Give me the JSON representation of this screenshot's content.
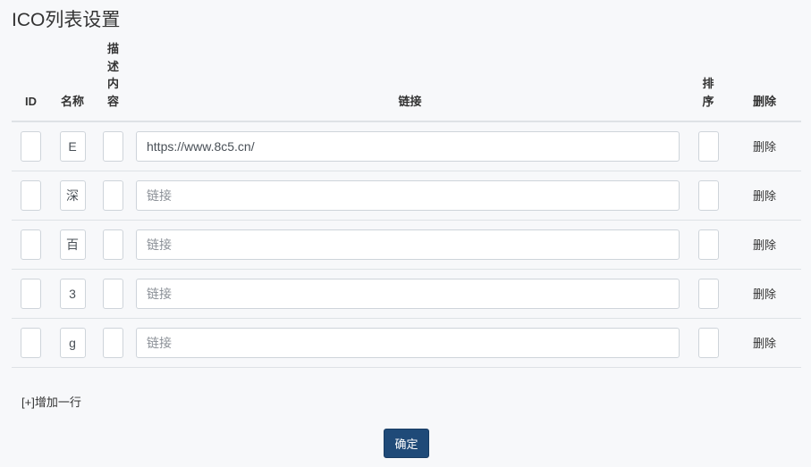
{
  "page": {
    "title": "ICO列表设置"
  },
  "table": {
    "headers": {
      "id": "ID",
      "name": "名称",
      "desc": "描述内容",
      "link": "链接",
      "sort": "排序",
      "delete": "删除"
    },
    "rows": [
      {
        "id": "",
        "name": "E",
        "desc": "",
        "link": "https://www.8c5.cn/",
        "link_placeholder": "链接",
        "sort": "",
        "delete_label": "删除"
      },
      {
        "id": "",
        "name": "深",
        "desc": "",
        "link": "",
        "link_placeholder": "链接",
        "sort": "",
        "delete_label": "删除"
      },
      {
        "id": "",
        "name": "百",
        "desc": "",
        "link": "",
        "link_placeholder": "链接",
        "sort": "",
        "delete_label": "删除"
      },
      {
        "id": "",
        "name": "3",
        "desc": "",
        "link": "",
        "link_placeholder": "链接",
        "sort": "",
        "delete_label": "删除"
      },
      {
        "id": "",
        "name": "g",
        "desc": "",
        "link": "",
        "link_placeholder": "链接",
        "sort": "",
        "delete_label": "删除"
      }
    ]
  },
  "actions": {
    "add_row_label": "[+]增加一行",
    "confirm_label": "确定"
  },
  "colors": {
    "primary_button": "#1f4a78",
    "background": "#f7f8fa",
    "border": "#dee2e6"
  }
}
